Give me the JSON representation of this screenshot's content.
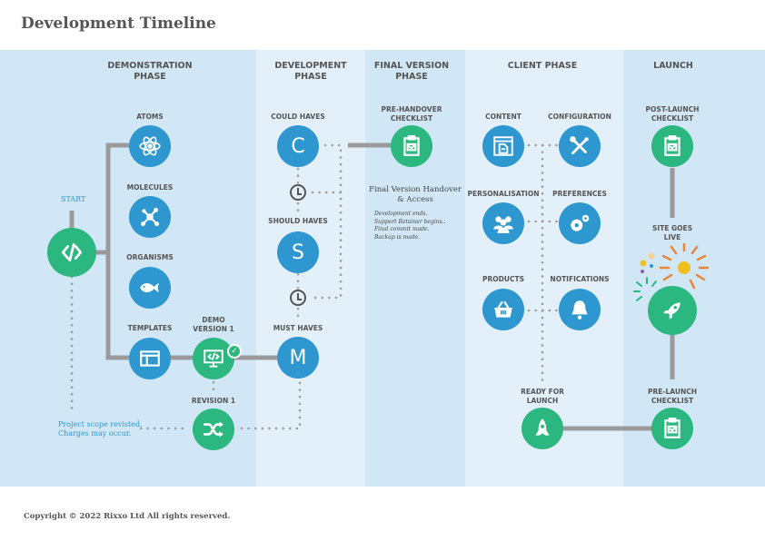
{
  "title": "Development Timeline",
  "phases": [
    {
      "label": "DEMONSTRATION\nPHASE"
    },
    {
      "label": "DEVELOPMENT\nPHASE"
    },
    {
      "label": "FINAL VERSION\nPHASE"
    },
    {
      "label": "CLIENT PHASE"
    },
    {
      "label": "LAUNCH"
    }
  ],
  "start_label": "START",
  "demo": {
    "atoms": "ATOMS",
    "molecules": "MOLECULES",
    "organisms": "ORGANISMS",
    "templates": "TEMPLATES",
    "demo_version": "DEMO\nVERSION 1",
    "revision": "REVISION 1",
    "scope_note": "Project scope revisted.\nCharges may occur."
  },
  "development": {
    "could": {
      "label": "COULD HAVES",
      "letter": "C"
    },
    "should": {
      "label": "SHOULD HAVES",
      "letter": "S"
    },
    "must": {
      "label": "MUST HAVES",
      "letter": "M"
    }
  },
  "final": {
    "checklist": "PRE-HANDOVER\nCHECKLIST",
    "handover_title": "Final Version Handover\n& Access",
    "handover_notes": "Development ends.\nSupport Retainer begins..\nFinal commit made.\nBackup is made."
  },
  "client": {
    "content": "CONTENT",
    "configuration": "CONFIGURATION",
    "personalisation": "PERSONALISATION",
    "preferences": "PREFERENCES",
    "products": "PRODUCTS",
    "notifications": "NOTIFICATIONS",
    "ready": "READY FOR\nLAUNCH"
  },
  "launch": {
    "post_checklist": "POST-LAUNCH\nCHECKLIST",
    "live": "SITE GOES\nLIVE",
    "pre_checklist": "PRE-LAUNCH\nCHECKLIST"
  },
  "footer": "Copyright © 2022 Rixxo Ltd All rights reserved.",
  "colors": {
    "blue": "#2e97cf",
    "green": "#2bb77f",
    "connector": "#9a9a9a",
    "band_dark": "#d1e7f5",
    "band_light": "#e3f0fa"
  }
}
